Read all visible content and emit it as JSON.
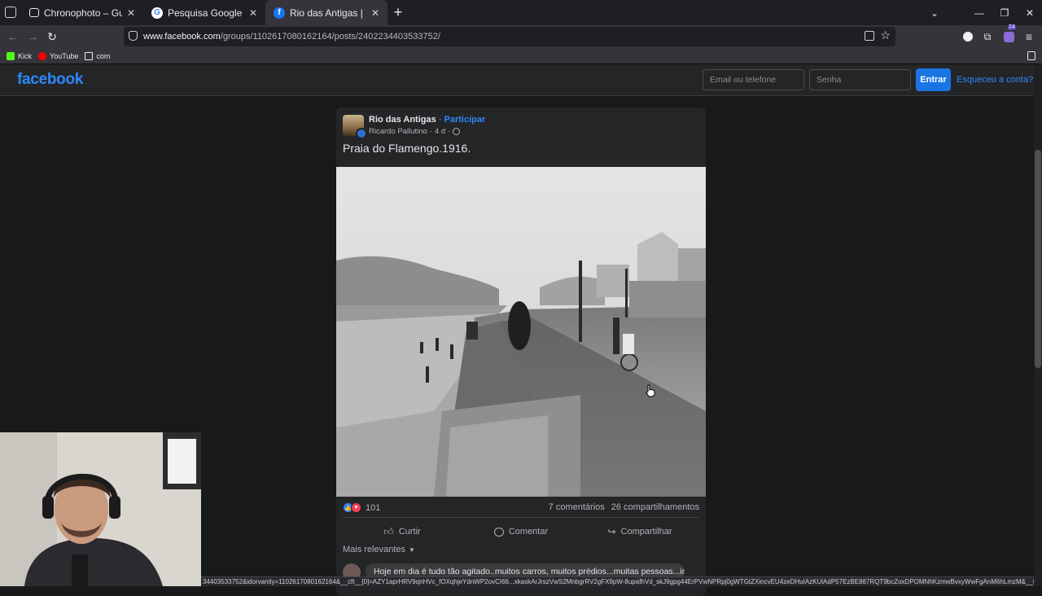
{
  "browser": {
    "tabs": [
      {
        "title": "Chronophoto – Guess the Year",
        "active": false
      },
      {
        "title": "Pesquisa Google",
        "active": false
      },
      {
        "title": "Rio das Antigas | Praia do Flamengo",
        "active": true
      }
    ],
    "url_host": "www.facebook.com",
    "url_path": "/groups/1102617080162164/posts/2402234403533752/",
    "bookmarks": [
      {
        "label": "Kick"
      },
      {
        "label": "YouTube"
      },
      {
        "label": "com"
      }
    ],
    "extension_badge": "24",
    "status_url": "34403533752&idorvanity=1102617080162164&__cft__[0]=AZY1aprHRV9qnHVc_fOXqhjeYdnWP2ovCI66...xkaskArJrszVwS2MnbgrRV2gFX9pW-8upafhVd_skJ9gpg44ErPVwNPRpj0gWTGtZXincvEU4zeDHuIAzKUiAdP57EzBE887RQT9bcZoxDPOMNhKzmwBvxyWwFgAnM6hLmzM&__tn__=EH-R"
  },
  "header": {
    "logo": "facebook",
    "email_placeholder": "Email ou telefone",
    "password_placeholder": "Senha",
    "login_label": "Entrar",
    "forgot_label": "Esqueceu a conta?"
  },
  "post": {
    "group_name": "Rio das Antigas",
    "separator": " · ",
    "join_label": "Participar",
    "author": "Ricardo Pallutino",
    "time": "4 d",
    "text": "Praia do Flamengo.1916.",
    "reaction_count": "101",
    "comments": "7 comentários",
    "shares": "26 compartilhamentos",
    "like_label": "Curtir",
    "comment_label": "Comentar",
    "share_label": "Compartilhar",
    "sort_label": "Mais relevantes",
    "first_comment": "Hoje em dia é tudo tão agitado..muitos carros, muitos prédios...muitas pessoas...indo"
  },
  "colors": {
    "fb_blue": "#2d88ff",
    "button_blue": "#1b74e4",
    "surface": "#242526",
    "background": "#18191a"
  }
}
